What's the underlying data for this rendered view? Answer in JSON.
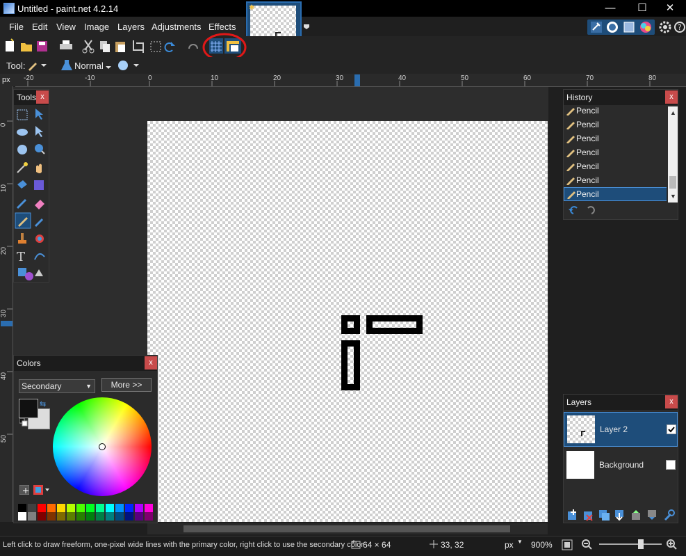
{
  "window": {
    "title": "Untitled - paint.net 4.2.14",
    "minimize": "—",
    "maximize": "☐",
    "close": "✕"
  },
  "menu": [
    "File",
    "Edit",
    "View",
    "Image",
    "Layers",
    "Adjustments",
    "Effects"
  ],
  "toolbar": {
    "tool_label": "Tool:",
    "blend_mode": "Normal"
  },
  "ruler": {
    "unit": "px",
    "h_ticks": [
      "-20",
      "-10",
      "0",
      "10",
      "20",
      "30",
      "40",
      "50",
      "60",
      "70",
      "80"
    ],
    "v_ticks": [
      "0",
      "10",
      "20",
      "30",
      "40",
      "50"
    ]
  },
  "tools_panel": {
    "title": "Tools",
    "close": "x"
  },
  "history_panel": {
    "title": "History",
    "close": "x",
    "items": [
      "Pencil",
      "Pencil",
      "Pencil",
      "Pencil",
      "Pencil",
      "Pencil",
      "Pencil"
    ]
  },
  "colors_panel": {
    "title": "Colors",
    "close": "x",
    "mode": "Secondary",
    "more_button": "More >>"
  },
  "layers_panel": {
    "title": "Layers",
    "close": "x",
    "layers": [
      {
        "name": "Layer 2",
        "visible": true,
        "selected": true
      },
      {
        "name": "Background",
        "visible": false,
        "selected": false
      }
    ]
  },
  "status": {
    "hint": "Left click to draw freeform, one-pixel wide lines with the primary color, right click to use the secondary color",
    "image_size": "64 × 64",
    "cursor_pos": "33, 32",
    "unit": "px",
    "zoom": "900%"
  },
  "colors": {
    "accent": "#1e4d7a",
    "close_red": "#c84b4b",
    "annotation_red": "#e01818"
  }
}
